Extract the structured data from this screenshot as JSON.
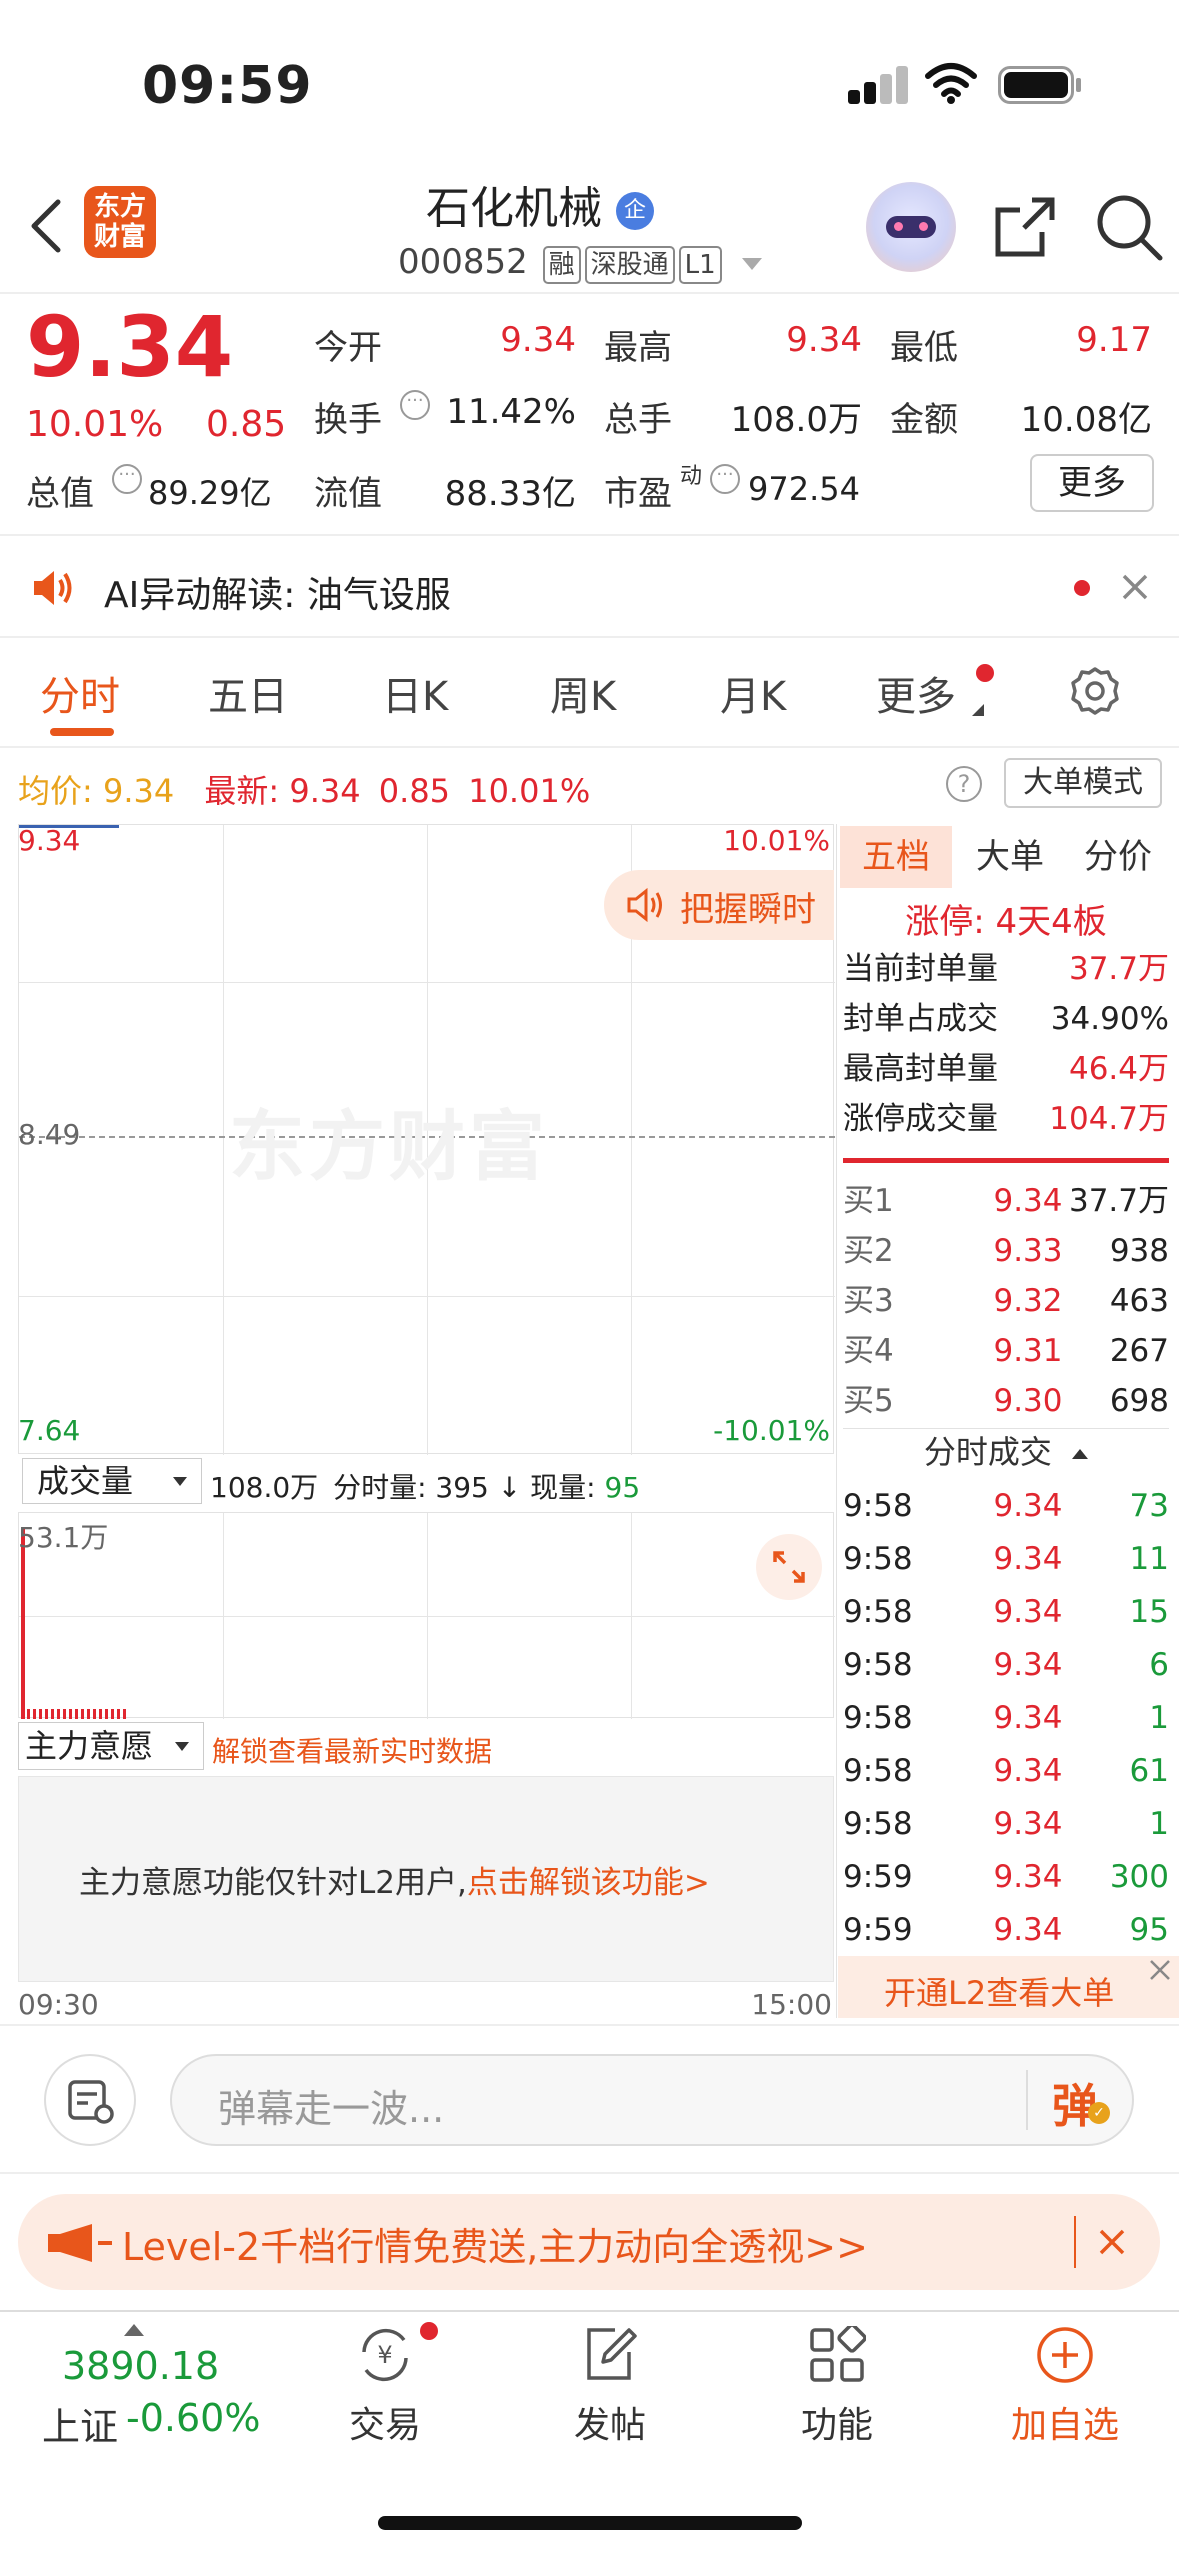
{
  "status": {
    "time": "09:59"
  },
  "header": {
    "logo_text": "东方\n财富",
    "stock_name": "石化机械",
    "name_badge": "企",
    "code": "000852",
    "tags": [
      "融",
      "深股通",
      "L1"
    ]
  },
  "quote": {
    "price": "9.34",
    "change_pct": "10.01%",
    "change_amt": "0.85",
    "open_label": "今开",
    "open": "9.34",
    "high_label": "最高",
    "high": "9.34",
    "low_label": "最低",
    "low": "9.17",
    "turnover_label": "换手",
    "turnover": "11.42%",
    "volume_label": "总手",
    "volume": "108.0万",
    "amount_label": "金额",
    "amount": "10.08亿",
    "mktcap_label": "总值",
    "mktcap": "89.29亿",
    "float_label": "流值",
    "float": "88.33亿",
    "pe_label": "市盈",
    "pe_sup": "动",
    "pe": "972.54",
    "more_button": "更多"
  },
  "ai_banner": {
    "prefix": "AI异动解读:",
    "text": "油气设服"
  },
  "tabs": [
    "分时",
    "五日",
    "日K",
    "周K",
    "月K",
    "更多"
  ],
  "chart_info": {
    "avg_label": "均价:",
    "avg": "9.34",
    "latest_label": "最新:",
    "latest": "9.34",
    "latest_chg": "0.85",
    "latest_pct": "10.01%",
    "mode_button": "大单模式"
  },
  "chart_data": {
    "type": "line",
    "y_top": "9.34",
    "y_mid": "8.49",
    "y_bottom": "7.64",
    "pct_top": "10.01%",
    "pct_bottom": "-10.01%",
    "x_start": "09:30",
    "x_end": "15:00",
    "watermark": "东方财富",
    "grasp_button": "把握瞬时"
  },
  "volume_panel": {
    "selector": "成交量",
    "total": "108.0万",
    "tick_label": "分时量:",
    "tick": "395",
    "arrow": "↓",
    "current_label": "现量:",
    "current": "95",
    "max_label": "53.1万"
  },
  "main_force": {
    "selector": "主力意愿",
    "unlock_text": "解锁查看最新实时数据",
    "notice": "主力意愿功能仅针对L2用户,",
    "notice_link": "点击解锁该功能>"
  },
  "right_panel": {
    "tabs": [
      "五档",
      "大单",
      "分价"
    ],
    "limit_up": "涨停: 4天4板",
    "seal_rows": [
      {
        "label": "当前封单量",
        "value": "37.7万"
      },
      {
        "label": "封单占成交",
        "value": "34.90%"
      },
      {
        "label": "最高封单量",
        "value": "46.4万"
      },
      {
        "label": "涨停成交量",
        "value": "104.7万"
      }
    ],
    "bids": [
      {
        "label": "买1",
        "price": "9.34",
        "vol": "37.7万"
      },
      {
        "label": "买2",
        "price": "9.33",
        "vol": "938"
      },
      {
        "label": "买3",
        "price": "9.32",
        "vol": "463"
      },
      {
        "label": "买4",
        "price": "9.31",
        "vol": "267"
      },
      {
        "label": "买5",
        "price": "9.30",
        "vol": "698"
      }
    ],
    "trades_title": "分时成交",
    "trades": [
      {
        "time": "9:58",
        "price": "9.34",
        "vol": "73"
      },
      {
        "time": "9:58",
        "price": "9.34",
        "vol": "11"
      },
      {
        "time": "9:58",
        "price": "9.34",
        "vol": "15"
      },
      {
        "time": "9:58",
        "price": "9.34",
        "vol": "6"
      },
      {
        "time": "9:58",
        "price": "9.34",
        "vol": "1"
      },
      {
        "time": "9:58",
        "price": "9.34",
        "vol": "61"
      },
      {
        "time": "9:58",
        "price": "9.34",
        "vol": "1"
      },
      {
        "time": "9:59",
        "price": "9.34",
        "vol": "300"
      },
      {
        "time": "9:59",
        "price": "9.34",
        "vol": "95"
      }
    ],
    "l2_banner": "开通L2查看大单"
  },
  "comment_bar": {
    "placeholder": "弹幕走一波...",
    "danmu_button": "弹"
  },
  "promo": {
    "text": "Level-2千档行情免费送,主力动向全透视>>"
  },
  "bottom_nav": {
    "index_value": "3890.18",
    "index_name": "上证",
    "index_pct": "-0.60%",
    "items": [
      "交易",
      "发帖",
      "功能",
      "加自选"
    ]
  },
  "colors": {
    "red": "#e0262f",
    "green": "#1a9a3a",
    "orange": "#e8561b"
  }
}
